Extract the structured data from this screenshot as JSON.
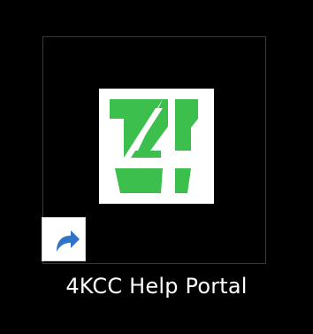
{
  "desktop": {
    "shortcut": {
      "label": "4KCC Help Portal",
      "icon": "4kcc-logo-icon",
      "badge_icon": "shortcut-arrow-icon",
      "selected": true
    }
  },
  "colors": {
    "background": "#000000",
    "label_text": "#ffffff",
    "logo_green": "#3cbf4c",
    "selection_border": "#3a3a3a",
    "shortcut_arrow": "#2f73c8"
  }
}
